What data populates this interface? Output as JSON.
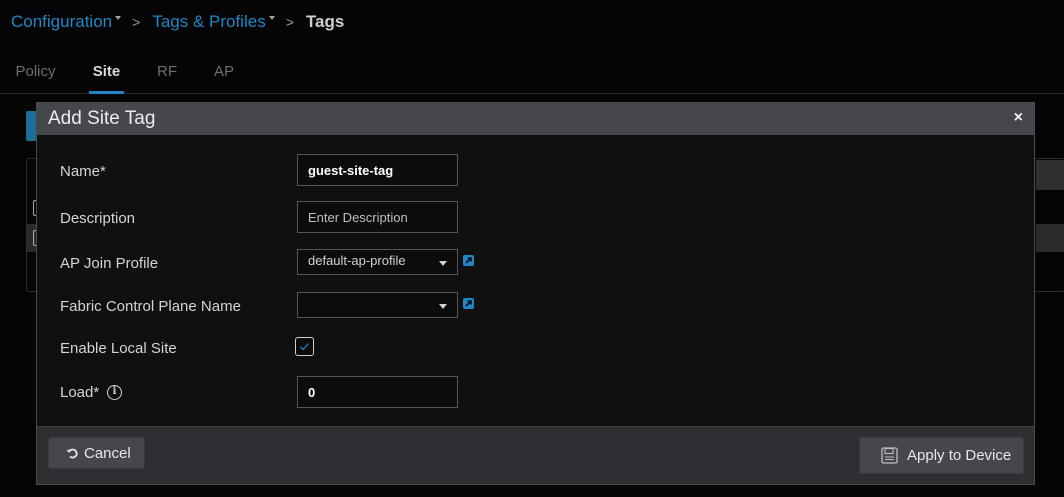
{
  "breadcrumb": {
    "items": [
      "Configuration",
      "Tags & Profiles"
    ],
    "current": "Tags",
    "separator": ">"
  },
  "tabs": [
    "Policy",
    "Site",
    "RF",
    "AP"
  ],
  "active_tab": "Site",
  "modal": {
    "title": "Add Site Tag",
    "close_glyph": "×",
    "fields": {
      "name": {
        "label": "Name*",
        "value": "guest-site-tag"
      },
      "description": {
        "label": "Description",
        "placeholder": "Enter Description"
      },
      "ap_join_profile": {
        "label": "AP Join Profile",
        "selected": "default-ap-profile"
      },
      "fabric_control_plane": {
        "label": "Fabric Control Plane Name",
        "selected": ""
      },
      "enable_local_site": {
        "label": "Enable Local Site",
        "checked": true
      },
      "load": {
        "label": "Load*",
        "value": "0"
      }
    },
    "buttons": {
      "cancel": "Cancel",
      "apply": "Apply to Device"
    }
  },
  "colors": {
    "accent": "#1f86c7",
    "modal_header": "#46464d",
    "background": "#050505"
  }
}
